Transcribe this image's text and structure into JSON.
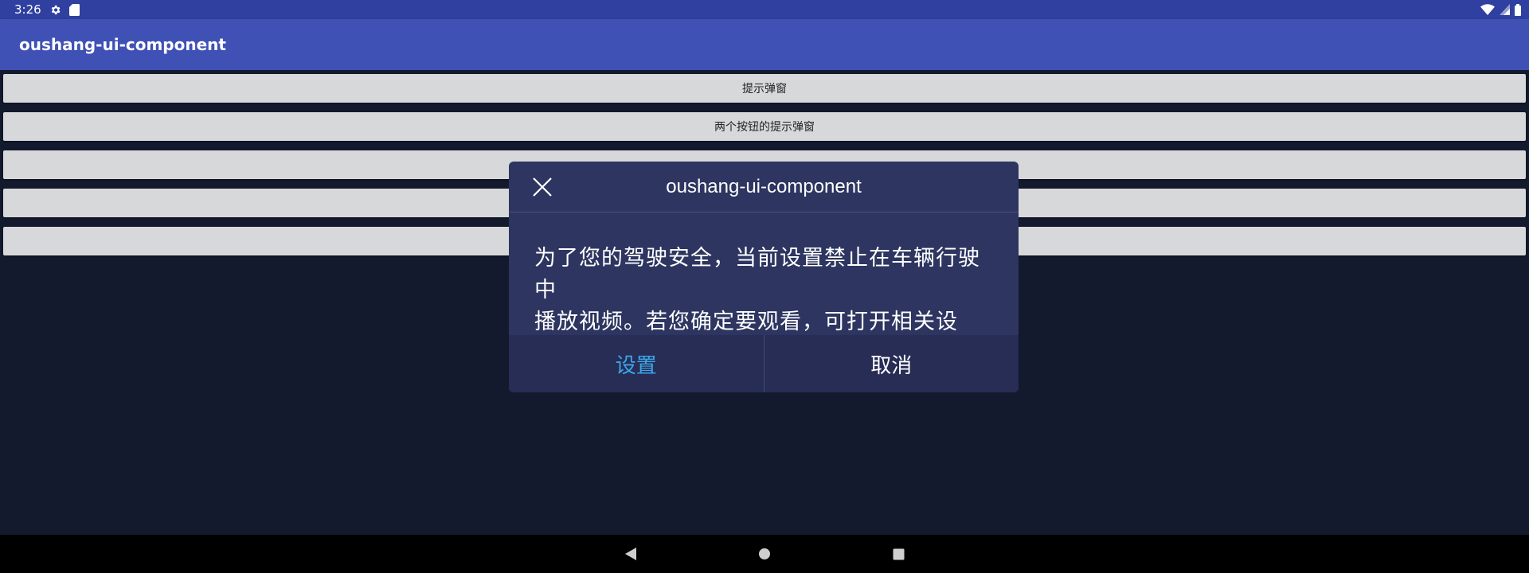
{
  "status_bar": {
    "time": "3:26",
    "icons": [
      "gear-icon",
      "sd-card-icon",
      "wifi-icon",
      "signal-icon",
      "battery-icon"
    ]
  },
  "app_bar": {
    "title": "oushang-ui-component"
  },
  "buttons": [
    {
      "label": "提示弹窗"
    },
    {
      "label": "两个按钮的提示弹窗"
    },
    {
      "label": ""
    },
    {
      "label": ""
    },
    {
      "label": ""
    }
  ],
  "dialog": {
    "title": "oushang-ui-component",
    "message_line1": "为了您的驾驶安全，当前设置禁止在车辆行驶中",
    "message_line2": "播放视频。若您确定要观看，可打开相关设置。",
    "confirm_label": "设置",
    "cancel_label": "取消",
    "close_icon": "close-icon"
  },
  "nav_bar": {
    "icons": [
      "back-icon",
      "home-icon",
      "recents-icon"
    ]
  },
  "colors": {
    "status_bar": "#3040a0",
    "app_bar": "#3f51b5",
    "background": "#131a2e",
    "dialog_bg": "#2d3560",
    "confirm_text": "#3ba7e8",
    "list_button": "#d7d8d9"
  }
}
